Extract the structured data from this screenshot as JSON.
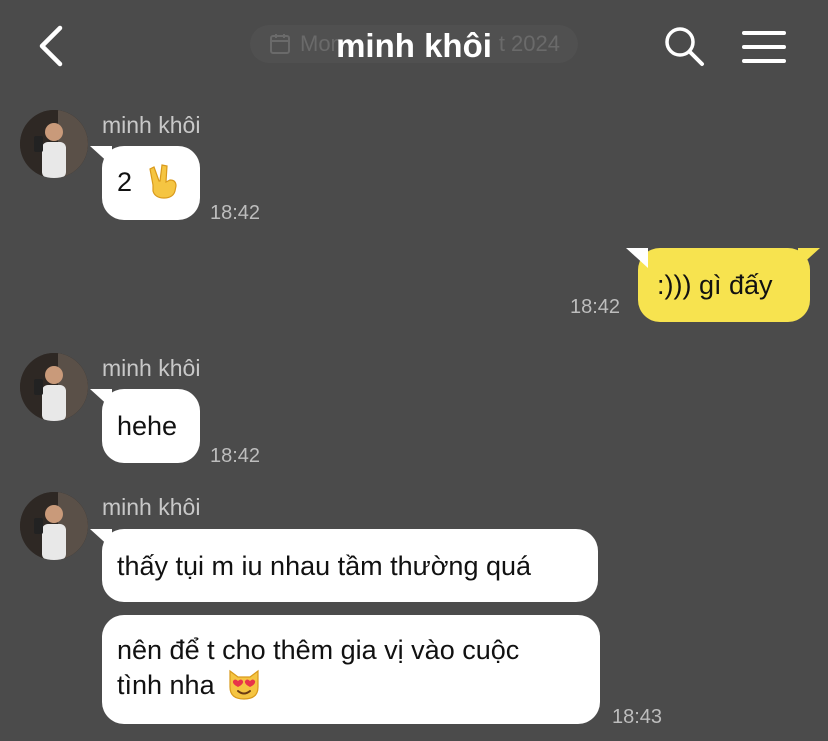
{
  "header": {
    "title": "minh khôi",
    "date_left": "Mon",
    "date_right": "t 2024",
    "icons": {
      "back": "chevron-left-icon",
      "calendar": "calendar-icon",
      "search": "search-icon",
      "menu": "hamburger-menu-icon"
    }
  },
  "colors": {
    "background": "#4b4b4b",
    "incoming_bubble": "#ffffff",
    "outgoing_bubble": "#f7e34f",
    "timestamp": "#bdbdbd"
  },
  "messages": [
    {
      "sender": "minh khôi",
      "text": "2",
      "emoji": "victory-hand-emoji",
      "time": "18:42"
    },
    {
      "text": ":))) gì đấy",
      "time": "18:42"
    },
    {
      "sender": "minh khôi",
      "text": "hehe",
      "time": "18:42"
    },
    {
      "sender": "minh khôi",
      "text": "thấy tụi m iu nhau tầm thường quá"
    },
    {
      "text_line1": "nên để t cho thêm gia vị vào cuộc",
      "text_line2": "tình nha",
      "emoji": "heart-eyes-cat-emoji",
      "time": "18:43"
    }
  ]
}
